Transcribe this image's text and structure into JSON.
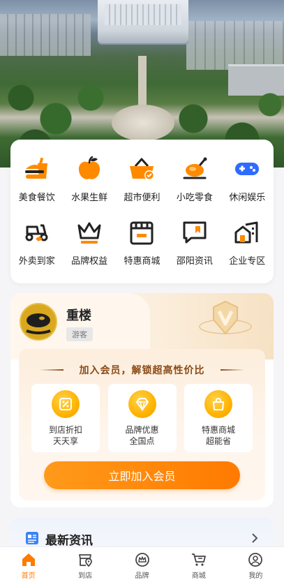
{
  "colors": {
    "accent": "#ff7a00",
    "icon_orange": "#ff8a00",
    "icon_dark": "#222222",
    "promo_brown": "#8a4a16"
  },
  "categories": [
    {
      "label": "美食餐饮",
      "icon": "burger-drink-icon"
    },
    {
      "label": "水果生鲜",
      "icon": "apple-icon"
    },
    {
      "label": "超市便利",
      "icon": "shopping-basket-icon"
    },
    {
      "label": "小吃零食",
      "icon": "roast-chicken-icon"
    },
    {
      "label": "休闲娱乐",
      "icon": "gamepad-icon"
    },
    {
      "label": "外卖到家",
      "icon": "delivery-scooter-icon"
    },
    {
      "label": "品牌权益",
      "icon": "crown-icon"
    },
    {
      "label": "特惠商城",
      "icon": "storefront-icon"
    },
    {
      "label": "邵阳资讯",
      "icon": "message-bookmark-icon"
    },
    {
      "label": "企业专区",
      "icon": "building-icon"
    }
  ],
  "member": {
    "name": "重楼",
    "tag": "游客",
    "promo_title": "加入会员，解锁超高性价比",
    "perks": [
      {
        "line1": "到店折扣",
        "line2": "天天享",
        "icon": "percent-tag-icon"
      },
      {
        "line1": "品牌优惠",
        "line2": "全国点",
        "icon": "diamond-icon"
      },
      {
        "line1": "特惠商城",
        "line2": "超能省",
        "icon": "shopping-bag-icon"
      }
    ],
    "join_button": "立即加入会员"
  },
  "news": {
    "title": "最新资讯"
  },
  "tabs": [
    {
      "label": "首页",
      "icon": "home-icon",
      "active": true
    },
    {
      "label": "到店",
      "icon": "store-location-icon",
      "active": false
    },
    {
      "label": "品牌",
      "icon": "brand-crown-icon",
      "active": false
    },
    {
      "label": "商城",
      "icon": "cart-icon",
      "active": false
    },
    {
      "label": "我的",
      "icon": "user-icon",
      "active": false
    }
  ]
}
